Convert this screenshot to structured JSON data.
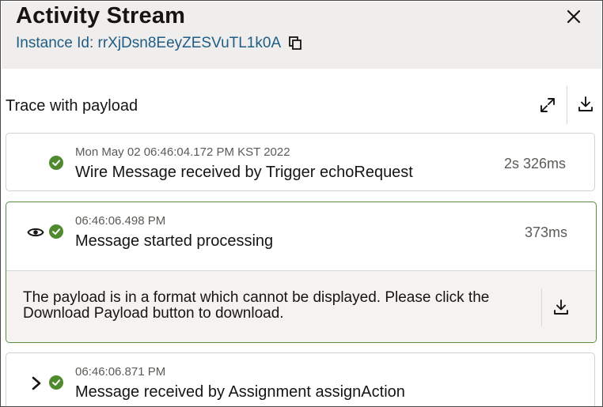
{
  "header": {
    "title": "Activity Stream",
    "instance_label": "Instance Id: rrXjDsn8EeyZESVuTL1k0A",
    "close_icon": "close-icon",
    "copy_icon": "copy-icon"
  },
  "trace": {
    "label": "Trace with payload",
    "expand_icon": "expand-icon",
    "download_icon": "download-icon"
  },
  "activities": [
    {
      "timestamp": "Mon May 02 06:46:04.172 PM KST 2022",
      "message": "Wire Message received by Trigger echoRequest",
      "duration": "2s 326ms",
      "status": "success"
    },
    {
      "timestamp": "06:46:06.498 PM",
      "message": "Message started processing",
      "duration": "373ms",
      "status": "success",
      "expanded": true,
      "payload_message": "The payload is in a format which cannot be displayed. Please click the Download Payload button to download."
    },
    {
      "timestamp": "06:46:06.871 PM",
      "message": "Message received by Assignment assignAction",
      "status": "success",
      "expanded": false
    }
  ],
  "colors": {
    "success": "#4f8a2e",
    "accent_link": "#1f5d84",
    "active_border": "#5b8b3d",
    "header_bg": "#efeeec"
  }
}
